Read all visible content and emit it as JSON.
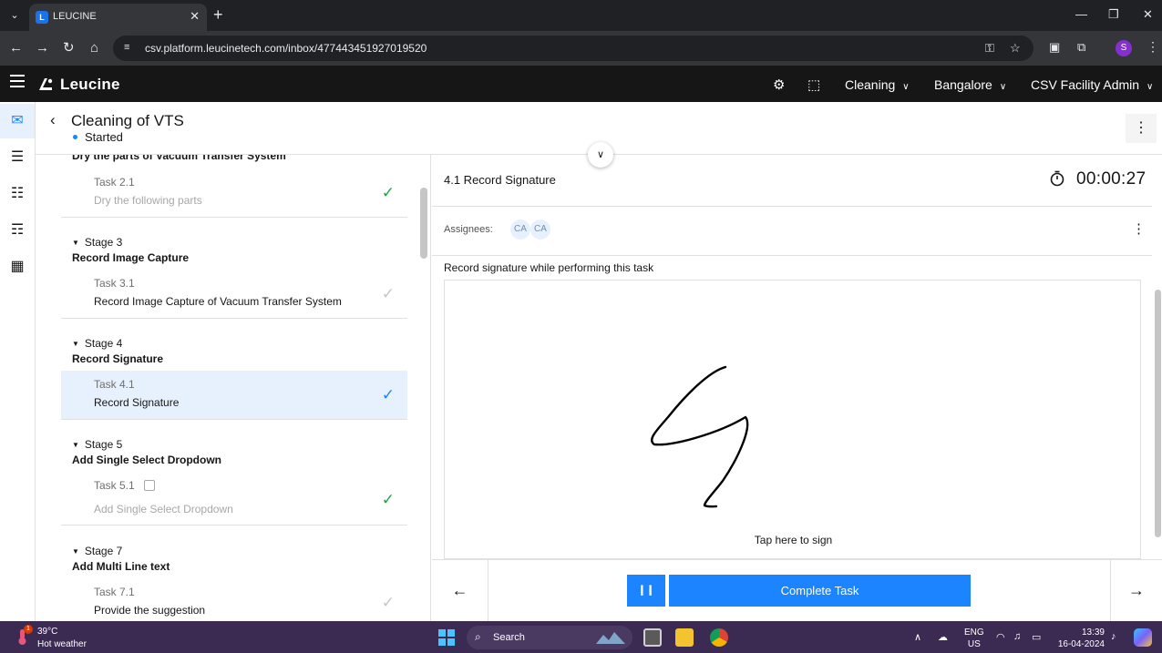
{
  "browser": {
    "tab_title": "LEUCINE",
    "url": "csv.platform.leucinetech.com/inbox/477443451927019520",
    "profile_initial": "S"
  },
  "app": {
    "brand": "Leucine",
    "use_case": "Cleaning",
    "facility": "Bangalore",
    "role": "CSV Facility Admin"
  },
  "page": {
    "title": "Cleaning of VTS",
    "status": "Started"
  },
  "stages": {
    "stage2_name": "Dry the parts of Vacuum Transfer System",
    "task21_num": "Task 2.1",
    "task21_name": "Dry the following parts",
    "stage3_label": "Stage 3",
    "stage3_name": "Record Image Capture",
    "task31_num": "Task 3.1",
    "task31_name": "Record Image Capture of Vacuum Transfer System",
    "stage4_label": "Stage 4",
    "stage4_name": "Record Signature",
    "task41_num": "Task 4.1",
    "task41_name": "Record Signature",
    "stage5_label": "Stage 5",
    "stage5_name": "Add Single Select Dropdown",
    "task51_num": "Task 5.1",
    "task51_name": "Add Single Select Dropdown",
    "stage7_label": "Stage 7",
    "stage7_name": "Add Multi Line text",
    "task71_num": "Task 7.1",
    "task71_name": "Provide the suggestion"
  },
  "task": {
    "title": "4.1 Record Signature",
    "timer": "00:00:27",
    "assignees_label": "Assignees:",
    "assignees": [
      "CA",
      "CA"
    ],
    "instruction": "Record signature while performing this task",
    "sign_hint": "Tap here to sign",
    "complete_label": "Complete Task"
  },
  "taskbar": {
    "temperature": "39°C",
    "weather": "Hot weather",
    "weather_badge": "1",
    "search_placeholder": "Search",
    "lang_line1": "ENG",
    "lang_line2": "US",
    "time": "13:39",
    "date": "16-04-2024"
  },
  "colors": {
    "accent": "#1d84ff",
    "header_bg": "#161616",
    "success": "#24a148",
    "taskbar_bg": "#3b2a52"
  }
}
